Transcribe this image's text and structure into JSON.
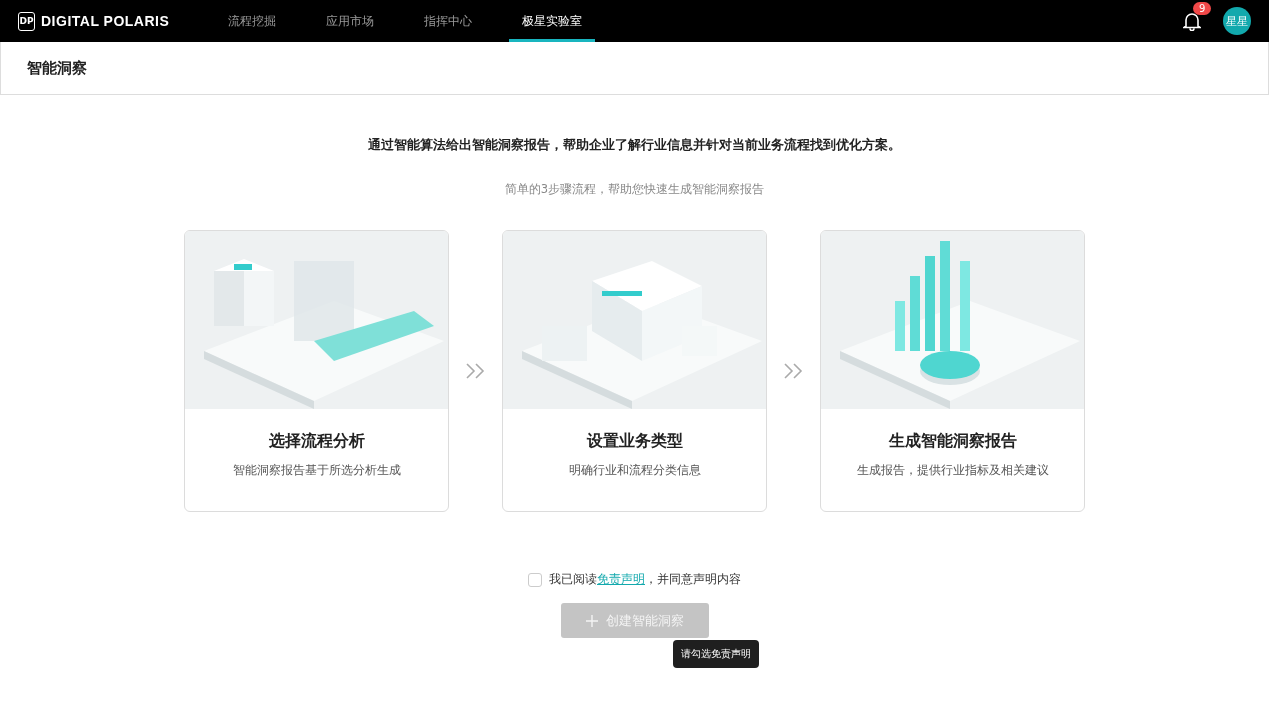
{
  "header": {
    "logo_mark": "DP",
    "logo_text": "DIGITAL POLARIS",
    "nav": [
      {
        "label": "流程挖掘",
        "selected": false
      },
      {
        "label": "应用市场",
        "selected": false
      },
      {
        "label": "指挥中心",
        "selected": false
      },
      {
        "label": "极星实验室",
        "selected": true
      }
    ],
    "notifications": {
      "count": "9"
    },
    "avatar": "星星"
  },
  "page_title": "智能洞察",
  "headline": "通过智能算法给出智能洞察报告，帮助企业了解行业信息并针对当前业务流程找到优化方案。",
  "subtitle": "简单的3步骤流程，帮助您快速生成智能洞察报告",
  "steps": [
    {
      "title": "选择流程分析",
      "description": "智能洞察报告基于所选分析生成"
    },
    {
      "title": "设置业务类型",
      "description": "明确行业和流程分类信息"
    },
    {
      "title": "生成智能洞察报告",
      "description": "生成报告，提供行业指标及相关建议"
    }
  ],
  "agreement": {
    "checked": false,
    "prefix": "我已阅读",
    "link": "免责声明",
    "suffix": "，并同意声明内容"
  },
  "create_button": {
    "label": "创建智能洞察",
    "disabled": true
  },
  "tooltip": "请勾选免责声明"
}
